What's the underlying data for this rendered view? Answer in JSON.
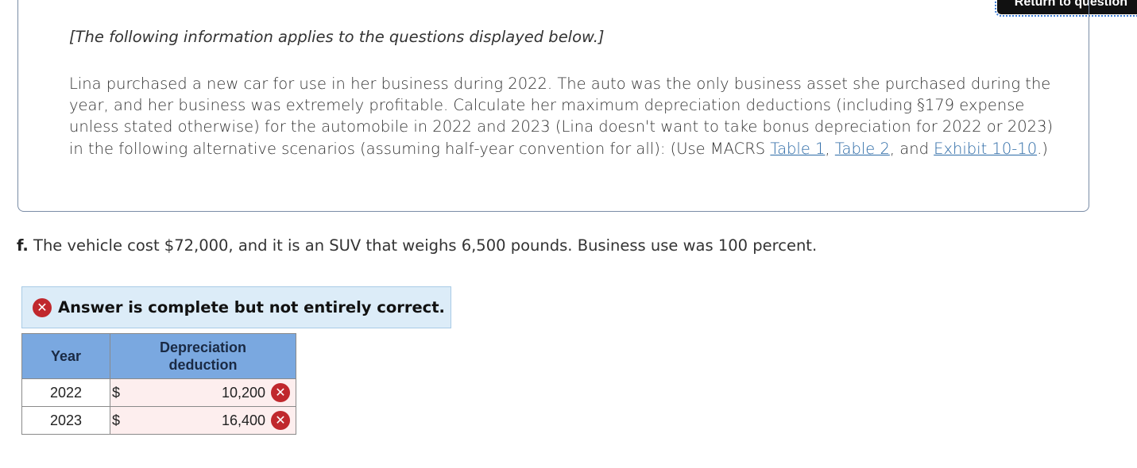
{
  "header": {
    "return_label": "Return to question"
  },
  "info": {
    "intro": "[The following information applies to the questions displayed below.]",
    "paragraph_text": "Lina purchased a new car for use in her business during 2022. The auto was the only business asset she purchased during the year, and her business was extremely profitable. Calculate her maximum depreciation deductions (including §179 expense unless stated otherwise) for the automobile in 2022 and 2023 (Lina doesn't want to take bonus depreciation for 2022 or 2023) in the following alternative scenarios (assuming half-year convention for all): (Use MACRS ",
    "link_table1": "Table 1",
    "sep1": ", ",
    "link_table2": "Table 2",
    "sep2": ", and ",
    "link_exhibit": "Exhibit 10-10",
    "paragraph_end": ".)"
  },
  "question": {
    "label": "f.",
    "text": " The vehicle cost $72,000, and it is an SUV that weighs 6,500 pounds. Business use was 100 percent."
  },
  "result": {
    "icon": "x-circle-icon",
    "message": "Answer is complete but not entirely correct.",
    "status_color": "#c0282d"
  },
  "table": {
    "col_year": "Year",
    "col_dep_line1": "Depreciation",
    "col_dep_line2": "deduction",
    "rows": [
      {
        "year": "2022",
        "currency": "$",
        "value": "10,200",
        "status": "incorrect"
      },
      {
        "year": "2023",
        "currency": "$",
        "value": "16,400",
        "status": "incorrect"
      }
    ]
  },
  "icons": {
    "incorrect_glyph": "✕"
  }
}
